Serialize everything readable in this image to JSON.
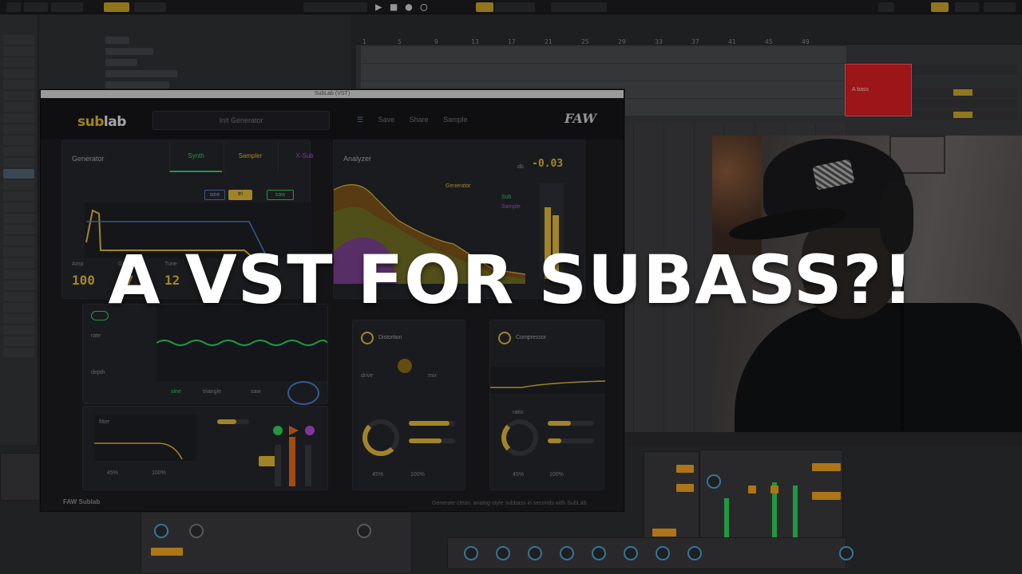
{
  "headline": "A VST FOR SUBASS?!",
  "daw": {
    "transport_display": "▶ ■ ● ◯",
    "ruler_marks": [
      "1",
      "5",
      "9",
      "13",
      "17",
      "21",
      "25",
      "29",
      "33",
      "37",
      "41",
      "45",
      "49"
    ],
    "clip_label": "A bass"
  },
  "plugin": {
    "window_title": "SubLab (VST)",
    "logo_a": "sub",
    "logo_b": "lab",
    "preset_name": "Init Generator",
    "menu": [
      "Save",
      "Share",
      "Sample"
    ],
    "brand": "FAW",
    "generator": {
      "title": "Generator",
      "tabs": [
        "Synth",
        "Sampler",
        "X-Sub"
      ],
      "buttons": [
        "sine",
        "tri",
        "saw"
      ],
      "labels": [
        "Amp",
        "Glide",
        "Tune"
      ],
      "readouts": [
        "100",
        "87",
        "12"
      ]
    },
    "analyzer": {
      "title": "Analyzer",
      "readout_prefix": "db",
      "readout": "-0.03",
      "legend": [
        "Generator",
        "Sub",
        "Sample"
      ]
    },
    "lfo": {
      "labels": [
        "rate",
        "depth"
      ],
      "tabs": [
        "sine",
        "triangle",
        "saw"
      ]
    },
    "distortion": {
      "title": "Distortion",
      "label_drive": "drive",
      "label_mix": "mix",
      "value_a": "45%",
      "value_b": "100%"
    },
    "compressor": {
      "title": "Compressor",
      "label": "ratio",
      "value_a": "45%",
      "value_b": "100%"
    },
    "filter": {
      "label": "filter",
      "values": [
        "45%",
        "100%"
      ]
    },
    "footer_logo": "FAW Sublab",
    "footer_note": "Generate clean, analog-style subbass in seconds with SubLab"
  },
  "colors": {
    "accent": "#e1b838",
    "green": "#2ed35a",
    "red_clip": "#d81e22",
    "purple": "#b44ad8"
  }
}
